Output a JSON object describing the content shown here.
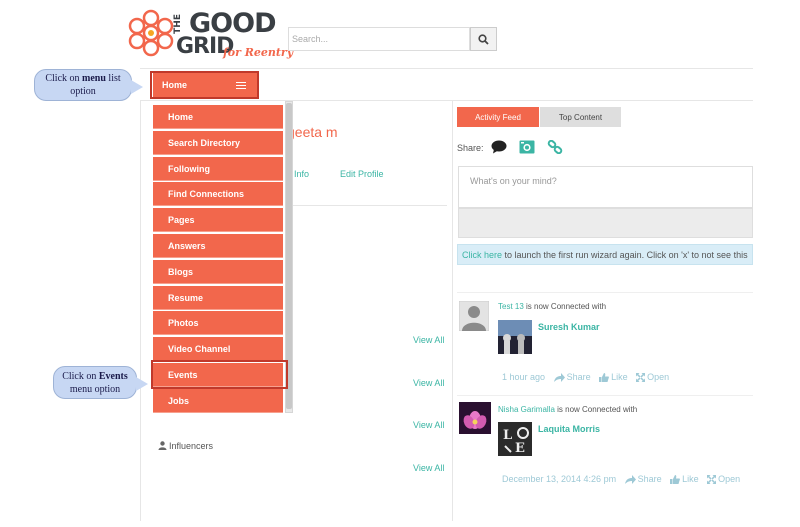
{
  "logo": {
    "the": "THE",
    "good": "GOOD",
    "grid": "GRID",
    "tagline": "for Reentry"
  },
  "search": {
    "placeholder": "Search..."
  },
  "nav": {
    "home_label": "Home"
  },
  "menu": {
    "items": [
      "Home",
      "Search Directory",
      "Following",
      "Find Connections",
      "Pages",
      "Answers",
      "Blogs",
      "Resume",
      "Photos",
      "Video Channel",
      "Events",
      "Jobs"
    ]
  },
  "callouts": {
    "menu": {
      "pre": "Click on ",
      "bold": "menu",
      "post": " list option"
    },
    "events": {
      "pre": "Click on ",
      "bold": "Events",
      "post": " menu option"
    }
  },
  "profile": {
    "name_partial": "geeta m",
    "edit_info": "it Info",
    "edit_profile": "Edit Profile"
  },
  "left": {
    "view_all": "View All",
    "influencers": "Influencers"
  },
  "tabs": {
    "activity": "Activity Feed",
    "top": "Top Content"
  },
  "share": {
    "label": "Share:"
  },
  "status": {
    "placeholder": "What's on your mind?"
  },
  "wizard": {
    "link": "Click here",
    "text": " to launch the first run wizard again. Click on 'x' to not see this"
  },
  "feed": [
    {
      "actor": "Test 13",
      "action": " is now Connected with",
      "target": "Suresh Kumar",
      "time": "1 hour ago",
      "share": "Share",
      "like": "Like",
      "open": "Open"
    },
    {
      "actor": "Nisha Garimalla",
      "action": " is now Connected with",
      "target": "Laquita Morris",
      "time": "December 13, 2014 4:26 pm",
      "share": "Share",
      "like": "Like",
      "open": "Open"
    }
  ],
  "colors": {
    "accent": "#f2674c",
    "teal": "#3bb5a4",
    "callout": "#c7d7f3",
    "highlight": "#c0392b"
  }
}
